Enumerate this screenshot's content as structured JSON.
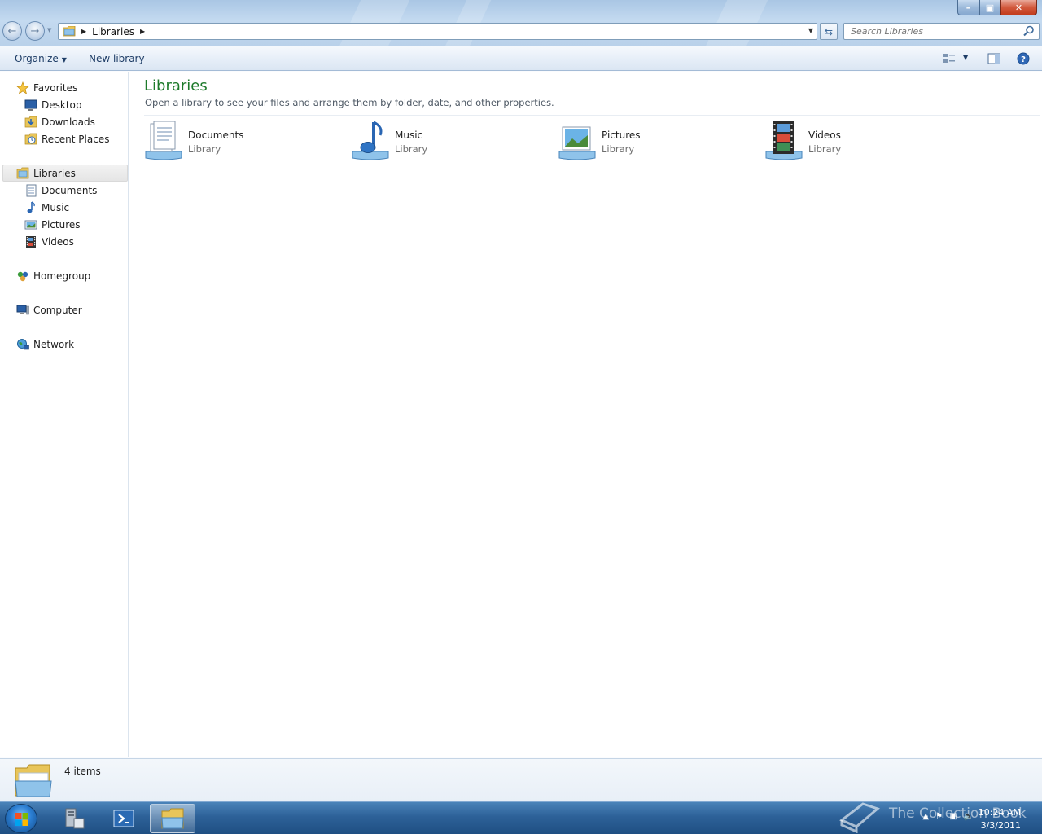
{
  "window": {
    "minimize_label": "–",
    "maximize_label": "▣",
    "close_label": "✕"
  },
  "address_bar": {
    "breadcrumb": [
      "Libraries"
    ],
    "search_placeholder": "Search Libraries"
  },
  "command_bar": {
    "organize_label": "Organize",
    "new_library_label": "New library",
    "icons": [
      "change-view-icon",
      "preview-pane-icon",
      "help-icon"
    ]
  },
  "nav_pane": {
    "favorites": {
      "label": "Favorites",
      "items": [
        "Desktop",
        "Downloads",
        "Recent Places"
      ]
    },
    "libraries": {
      "label": "Libraries",
      "items": [
        "Documents",
        "Music",
        "Pictures",
        "Videos"
      ]
    },
    "homegroup_label": "Homegroup",
    "computer_label": "Computer",
    "network_label": "Network"
  },
  "content": {
    "title": "Libraries",
    "subtitle": "Open a library to see your files and arrange them by folder, date, and other properties.",
    "libraries": [
      {
        "name": "Documents",
        "kind": "Library",
        "icon": "documents-library-icon"
      },
      {
        "name": "Music",
        "kind": "Library",
        "icon": "music-library-icon"
      },
      {
        "name": "Pictures",
        "kind": "Library",
        "icon": "pictures-library-icon"
      },
      {
        "name": "Videos",
        "kind": "Library",
        "icon": "videos-library-icon"
      }
    ]
  },
  "details_pane": {
    "item_count": "4 items"
  },
  "taskbar": {
    "pinned": [
      "server-manager-icon",
      "powershell-icon",
      "windows-explorer-icon"
    ],
    "active": "windows-explorer-icon",
    "time": "10:24 AM",
    "date": "3/3/2011",
    "watermark": "The Collection Book"
  },
  "colors": {
    "title_green": "#1d7a2a",
    "link_blue": "#1e3d66",
    "taskbar_blue": "#2d6198"
  }
}
